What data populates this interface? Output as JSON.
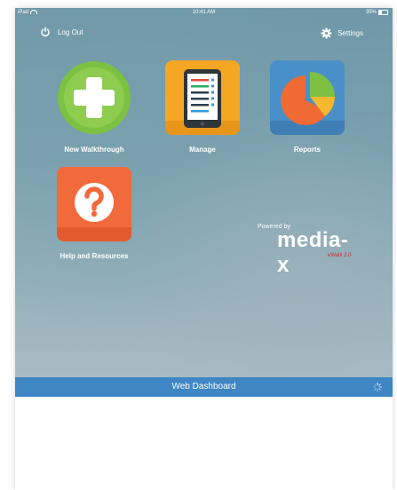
{
  "status_bar": {
    "device": "iPad",
    "time": "10:41 AM",
    "battery": "35%"
  },
  "header": {
    "logout_label": "Log Out",
    "settings_label": "Settings"
  },
  "tiles": [
    {
      "label": "New Walkthrough",
      "icon": "plus-icon",
      "color": "#7cc142"
    },
    {
      "label": "Manage",
      "icon": "tablet-checklist-icon",
      "color": "#f5a623"
    },
    {
      "label": "Reports",
      "icon": "pie-chart-icon",
      "color": "#4a90c8"
    },
    {
      "label": "Help and Resources",
      "icon": "question-icon",
      "color": "#f26a3b"
    }
  ],
  "branding": {
    "powered_by": "Powered by",
    "brand": "media-x",
    "version": "eWalk 2.0"
  },
  "dashboard": {
    "title": "Web Dashboard"
  }
}
